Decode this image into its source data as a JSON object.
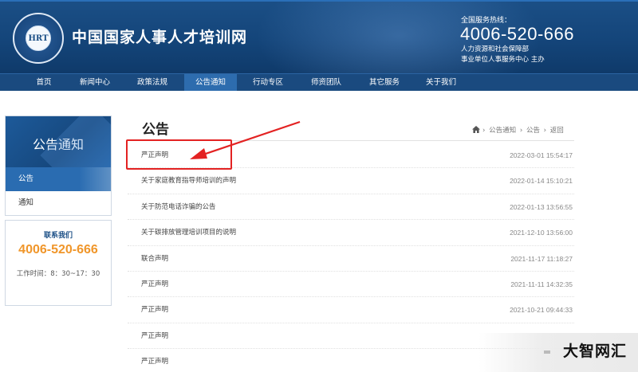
{
  "header": {
    "logo_text": "HRT",
    "site_title": "中国国家人事人才培训网",
    "hotline_label": "全国服务热线：",
    "hotline_number": "4006-520-666",
    "hotline_line1": "人力资源和社会保障部",
    "hotline_line2": "事业单位人事服务中心 主办"
  },
  "nav": {
    "items": [
      {
        "label": "首页"
      },
      {
        "label": "新闻中心"
      },
      {
        "label": "政策法规"
      },
      {
        "label": "公告通知"
      },
      {
        "label": "行动专区"
      },
      {
        "label": "师资团队"
      },
      {
        "label": "其它服务"
      },
      {
        "label": "关于我们"
      }
    ],
    "active_index": 3
  },
  "sidebar": {
    "title": "公告通知",
    "items": [
      {
        "label": "公告",
        "active": true
      },
      {
        "label": "通知",
        "active": false
      }
    ],
    "contact": {
      "title": "联系我们",
      "phone": "4006-520-666",
      "hours": "工作时间：8：30~17：30"
    }
  },
  "main": {
    "title": "公告",
    "breadcrumb": [
      "公告通知",
      "公告",
      "返回"
    ],
    "rows": [
      {
        "title": "严正声明",
        "date": "2022-03-01 15:54:17"
      },
      {
        "title": "关于家庭教育指导师培训的声明",
        "date": "2022-01-14 15:10:21"
      },
      {
        "title": "关于防范电话诈骗的公告",
        "date": "2022-01-13 13:56:55"
      },
      {
        "title": "关于碳排放管理培训项目的说明",
        "date": "2021-12-10 13:56:00"
      },
      {
        "title": "联合声明",
        "date": "2021-11-17 11:18:27"
      },
      {
        "title": "严正声明",
        "date": "2021-11-11 14:32:35"
      },
      {
        "title": "严正声明",
        "date": "2021-10-21 09:44:33"
      },
      {
        "title": "严正声明",
        "date": ""
      },
      {
        "title": "严正声明",
        "date": ""
      }
    ]
  },
  "watermark": {
    "text": "大智网汇"
  },
  "colors": {
    "header_bg": "#14457a",
    "nav_active": "#2d6cae",
    "annotation": "#e32222",
    "contact_phone": "#f0962a"
  }
}
